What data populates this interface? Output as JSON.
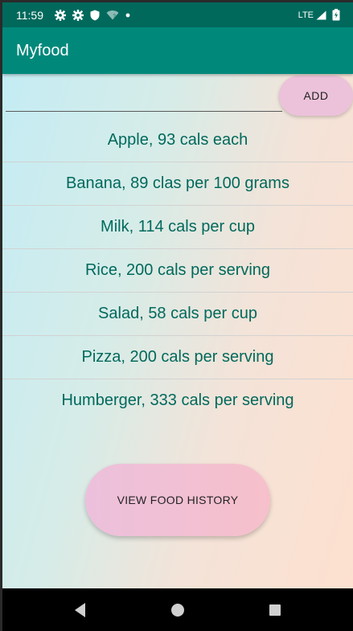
{
  "status_bar": {
    "time": "11:59",
    "network": "LTE",
    "icons": [
      "gear-icon",
      "gear-icon",
      "shield-icon",
      "wifi-icon",
      "dot-icon",
      "signal-icon",
      "battery-icon"
    ]
  },
  "app_bar": {
    "title": "Myfood"
  },
  "input": {
    "value": "",
    "placeholder": ""
  },
  "add_button": {
    "label": "ADD"
  },
  "food_list": [
    "Apple, 93 cals each",
    "Banana, 89 clas per 100 grams",
    "Milk, 114 cals per cup",
    "Rice, 200 cals per serving",
    "Salad, 58 cals per cup",
    "Pizza, 200 cals per serving",
    "Humberger, 333 cals per serving"
  ],
  "history_button": {
    "label": "VIEW FOOD HISTORY"
  },
  "nav_bar": {
    "icons": [
      "back-icon",
      "home-icon",
      "recents-icon"
    ]
  },
  "colors": {
    "status_bar": "#00695c",
    "app_bar": "#00897b",
    "list_text": "#00695c",
    "button_pink": "#ecc2da"
  }
}
